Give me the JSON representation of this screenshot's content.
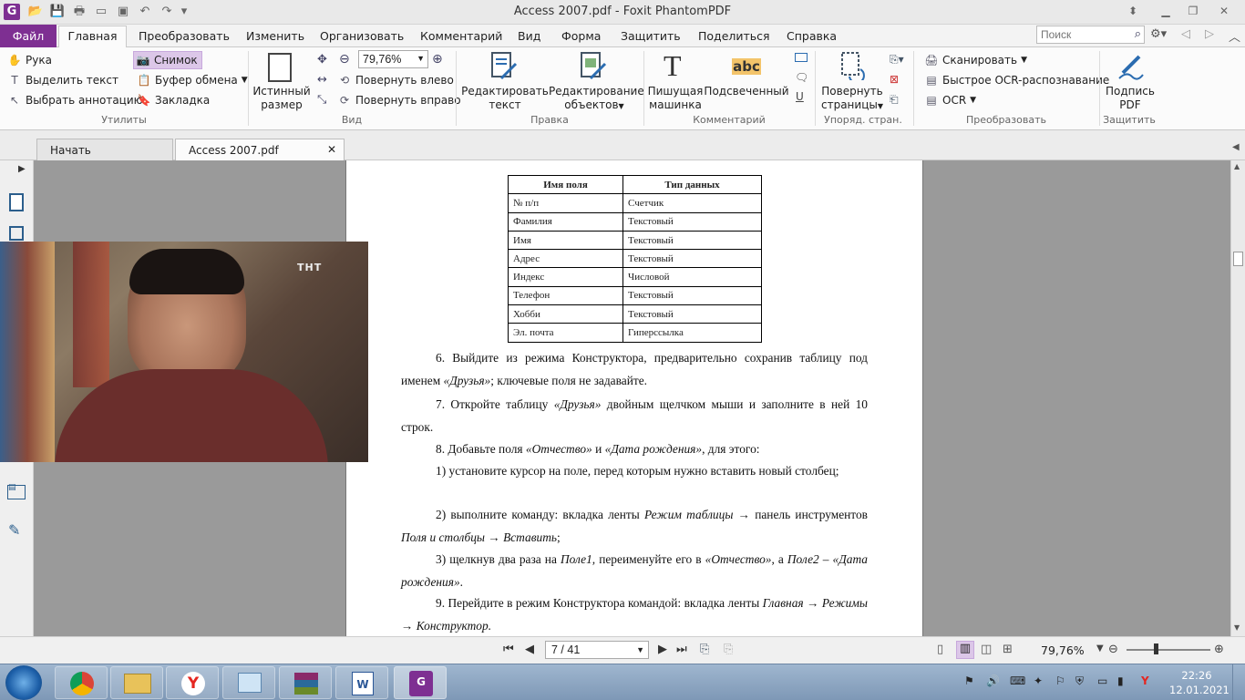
{
  "app": {
    "title": "Access 2007.pdf - Foxit PhantomPDF"
  },
  "menu": {
    "file": "Файл",
    "home": "Главная",
    "items": [
      "Преобразовать",
      "Изменить",
      "Организовать",
      "Комментарий",
      "Вид",
      "Форма",
      "Защитить",
      "Поделиться",
      "Справка"
    ],
    "search_placeholder": "Поиск"
  },
  "ribbon": {
    "tools": {
      "hand": "Рука",
      "select_text": "Выделить текст",
      "select_annot": "Выбрать аннотацию",
      "snapshot": "Снимок",
      "clipboard": "Буфер обмена",
      "bookmark": "Закладка",
      "label": "Утилиты"
    },
    "view": {
      "actual_size": "Истинный размер",
      "actual_size_l1": "Истинный",
      "actual_size_l2": "размер",
      "zoom": "79,76%",
      "rotate_left": "Повернуть влево",
      "rotate_right": "Повернуть вправо",
      "label": "Вид"
    },
    "edit": {
      "edit_text_l1": "Редактировать",
      "edit_text_l2": "текст",
      "edit_obj_l1": "Редактирование",
      "edit_obj_l2": "объектов",
      "label": "Правка"
    },
    "comment": {
      "typewriter_l1": "Пишущая",
      "typewriter_l2": "машинка",
      "highlight": "Подсвеченный",
      "label": "Комментарий"
    },
    "pages": {
      "rotate_l1": "Повернуть",
      "rotate_l2": "страницы",
      "label": "Упоряд. стран."
    },
    "convert": {
      "scan": "Сканировать",
      "quick_ocr": "Быстрое OCR-распознавание",
      "ocr": "OCR",
      "label": "Преобразовать"
    },
    "protect": {
      "sign_l1": "Подпись",
      "sign_l2": "PDF",
      "label": "Защитить"
    }
  },
  "tabs": {
    "start": "Начать",
    "doc": "Access 2007.pdf"
  },
  "document": {
    "table": {
      "headers": [
        "Имя поля",
        "Тип данных"
      ],
      "rows": [
        [
          "№ п/п",
          "Счетчик"
        ],
        [
          "Фамилия",
          "Текстовый"
        ],
        [
          "Имя",
          "Текстовый"
        ],
        [
          "Адрес",
          "Текстовый"
        ],
        [
          "Индекс",
          "Числовой"
        ],
        [
          "Телефон",
          "Текстовый"
        ],
        [
          "Хобби",
          "Текстовый"
        ],
        [
          "Эл. почта",
          "Гиперссылка"
        ]
      ]
    },
    "p6": [
      "6.  Выйдите из режима Конструктора, предварительно сохранив таблицу под именем ",
      "«Друзья»",
      "; ключевые поля не задавайте."
    ],
    "p7": [
      "7.  Откройте таблицу ",
      "«Друзья»",
      " двойным щелчком мыши и заполните в ней 10 строк."
    ],
    "p8": [
      "8.  Добавьте поля ",
      "«Отчество»",
      " и ",
      "«Дата рождения»",
      ", для этого:"
    ],
    "p8_1": "1)  установите курсор на поле, перед которым нужно вставить новый столбец;",
    "p8_2": [
      "2)  выполните команду: вкладка ленты ",
      "Режим таблицы",
      " → панель инструментов ",
      "Поля и столбцы",
      " → ",
      "Вставить",
      ";"
    ],
    "p8_3": [
      "3)  щелкнув два раза на ",
      "Поле1,",
      " переименуйте его в ",
      "«Отчество»",
      ", а ",
      "Поле2",
      " – ",
      "«Дата рождения»",
      "."
    ],
    "p9": [
      "9.  Перейдите в режим Конструктора командой: вкладка ленты ",
      "Главная",
      " → ",
      "Режимы",
      " → ",
      "Конструктор."
    ]
  },
  "status": {
    "page": "7 / 41",
    "zoom": "79,76%"
  },
  "taskbar": {
    "time": "22:26",
    "date": "12.01.2021"
  },
  "colors": {
    "file_tab": "#7e2f92",
    "ribbon_bg": "#fbfbfb",
    "taskbar": "#8ea6c2"
  }
}
